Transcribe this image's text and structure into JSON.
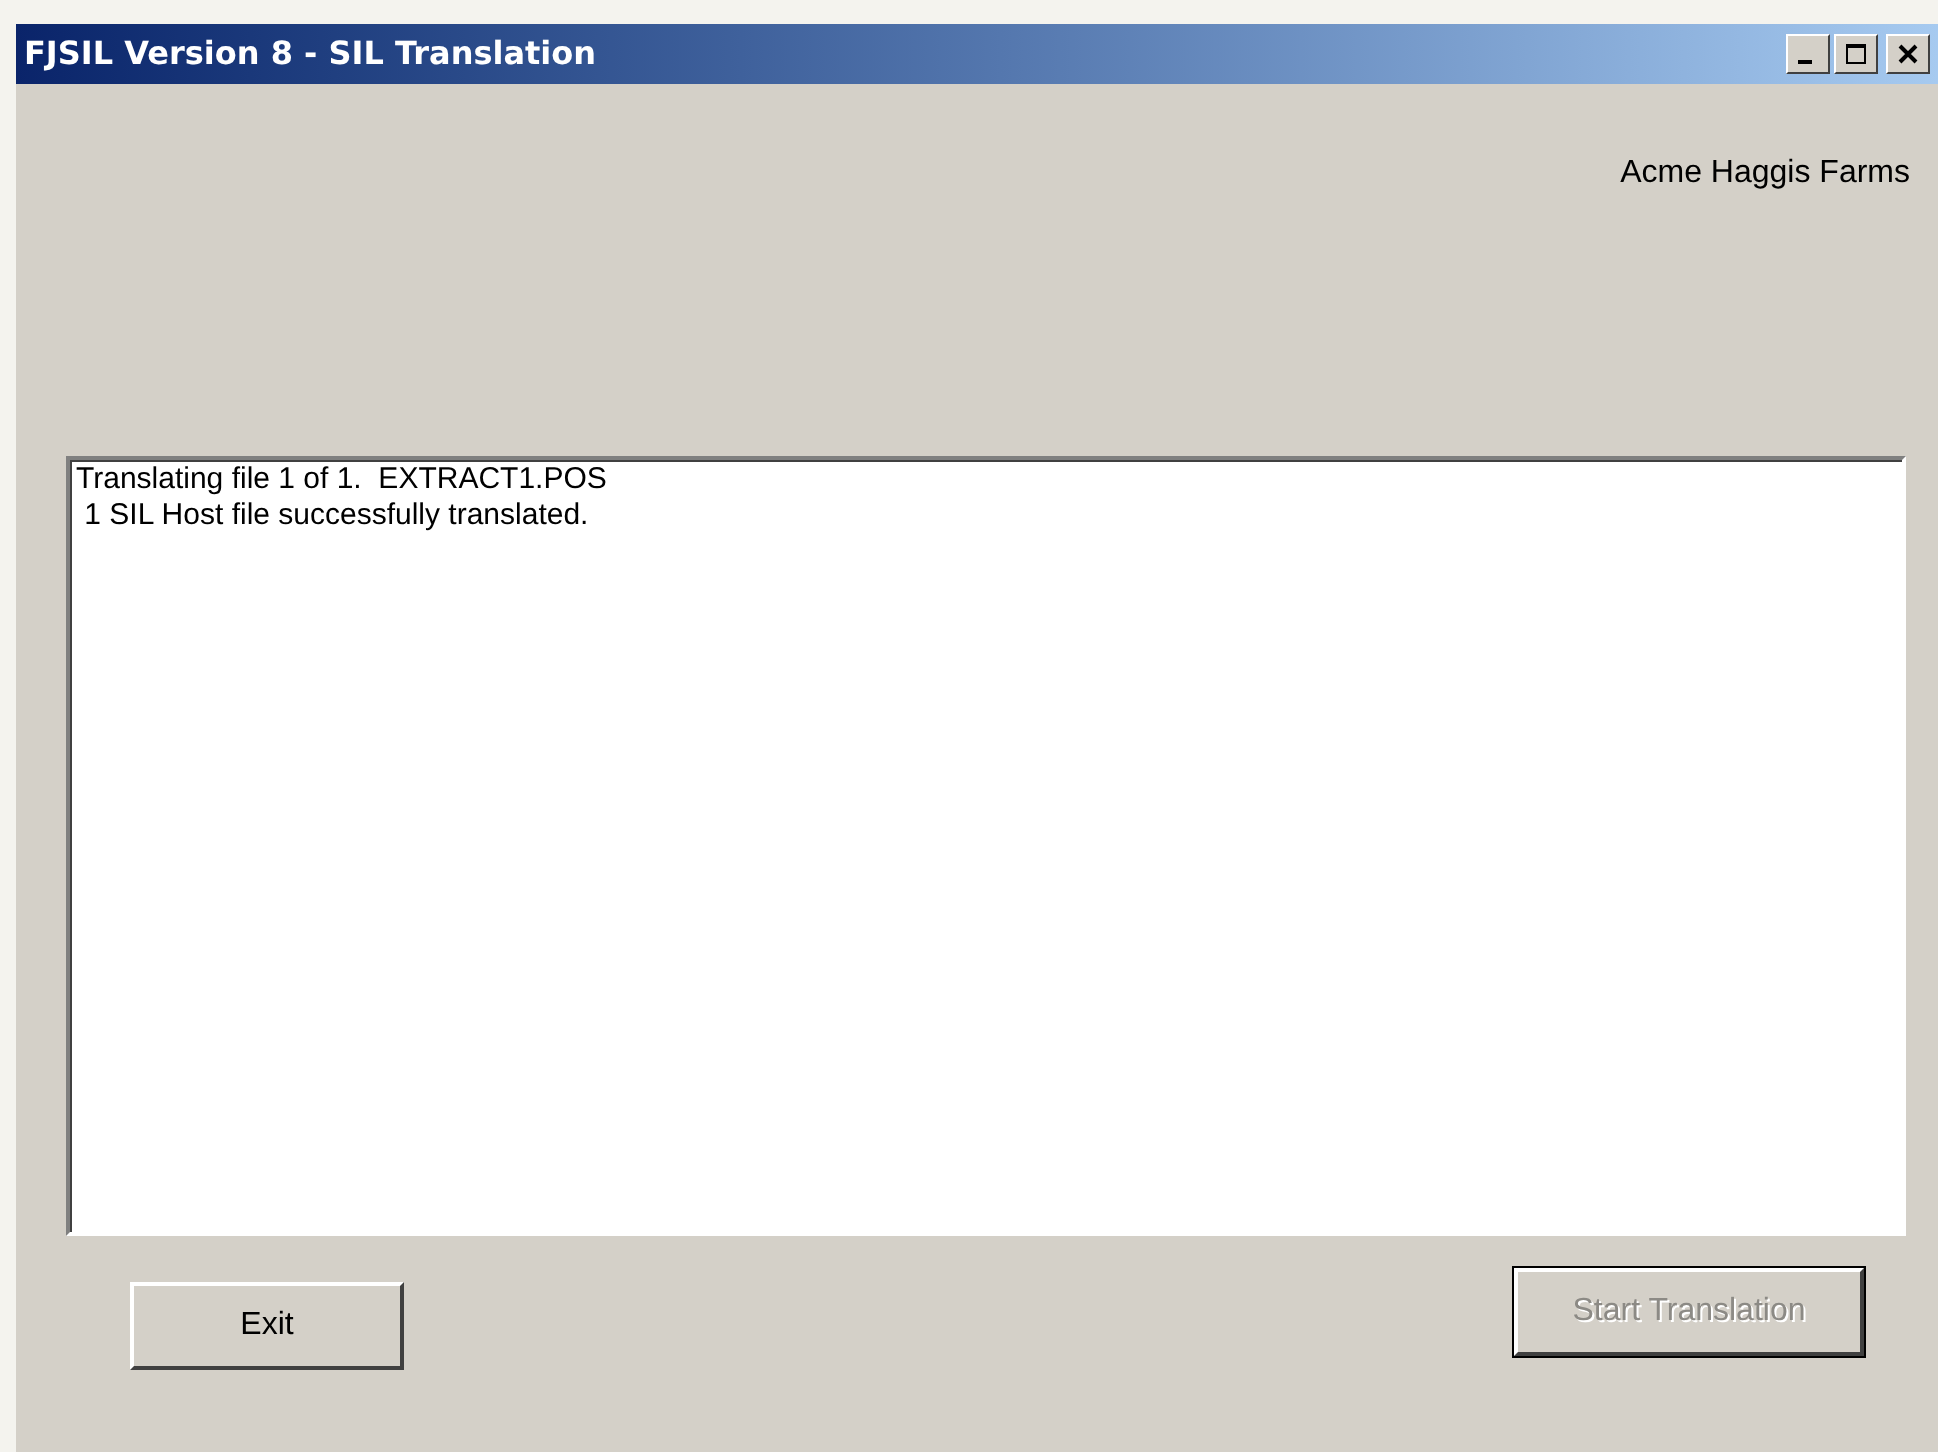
{
  "window": {
    "title": "FJSIL Version 8 - SIL Translation",
    "controls": [
      {
        "kind": "minimize"
      },
      {
        "kind": "maximize"
      },
      {
        "kind": "close"
      }
    ]
  },
  "company": "Acme Haggis Farms",
  "log": [
    "Translating file 1 of 1.  EXTRACT1.POS",
    " 1 SIL Host file successfully translated."
  ],
  "buttons": [
    {
      "label": "Exit",
      "disabled": false,
      "default": false
    },
    {
      "label": "Start Translation",
      "disabled": true,
      "default": true
    }
  ]
}
